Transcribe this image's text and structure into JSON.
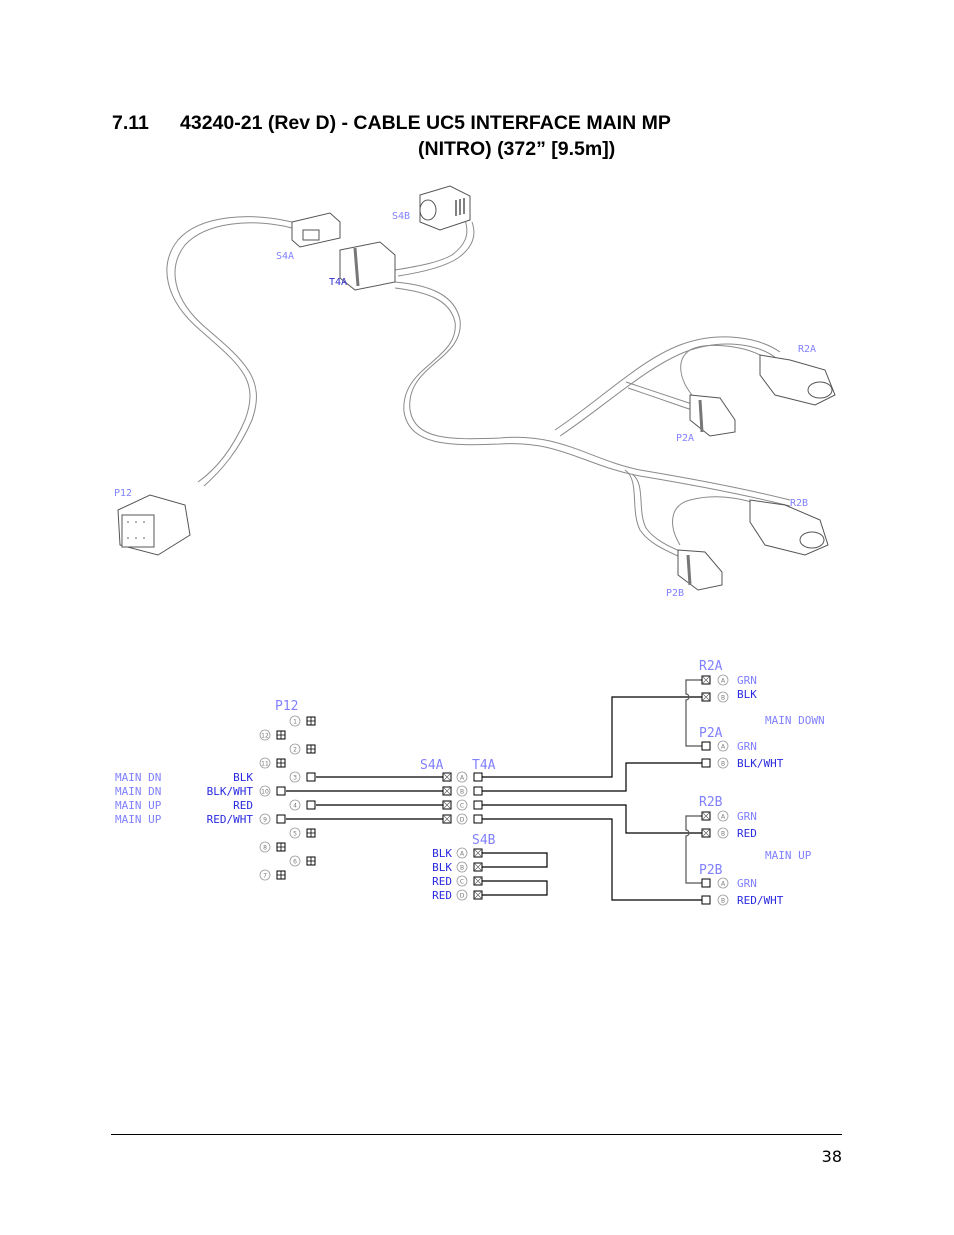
{
  "page": {
    "section_number": "7.11",
    "title_line1": "43240-21 (Rev D) - CABLE UC5 INTERFACE MAIN MP",
    "title_line2": "(NITRO) (372” [9.5m])",
    "page_number": "38"
  },
  "drawing_labels": {
    "s4b": "S4B",
    "s4a": "S4A",
    "t4a": "T4A",
    "p12": "P12",
    "r2a": "R2A",
    "p2a": "P2A",
    "r2b": "R2B",
    "p2b": "P2B"
  },
  "schematic": {
    "p12": {
      "label": "P12",
      "pins": [
        "1",
        "12",
        "2",
        "11",
        "3",
        "10",
        "4",
        "9",
        "5",
        "8",
        "6",
        "7"
      ],
      "wired_pins": [
        {
          "pin": "3",
          "function": "MAIN DN",
          "color": "BLK"
        },
        {
          "pin": "10",
          "function": "MAIN DN",
          "color": "BLK/WHT"
        },
        {
          "pin": "4",
          "function": "MAIN UP",
          "color": "RED"
        },
        {
          "pin": "9",
          "function": "MAIN UP",
          "color": "RED/WHT"
        }
      ]
    },
    "s4a": {
      "label": "S4A",
      "pins": [
        "A",
        "B",
        "C",
        "D"
      ]
    },
    "t4a": {
      "label": "T4A"
    },
    "s4b": {
      "label": "S4B",
      "pins": [
        {
          "pin": "A",
          "color": "BLK"
        },
        {
          "pin": "B",
          "color": "BLK"
        },
        {
          "pin": "C",
          "color": "RED"
        },
        {
          "pin": "D",
          "color": "RED"
        }
      ]
    },
    "r2a": {
      "label": "R2A",
      "pins": [
        {
          "pin": "A",
          "color": "GRN"
        },
        {
          "pin": "B",
          "color": "BLK"
        }
      ]
    },
    "main_down": "MAIN DOWN",
    "p2a": {
      "label": "P2A",
      "pins": [
        {
          "pin": "A",
          "color": "GRN"
        },
        {
          "pin": "B",
          "color": "BLK/WHT"
        }
      ]
    },
    "r2b": {
      "label": "R2B",
      "pins": [
        {
          "pin": "A",
          "color": "GRN"
        },
        {
          "pin": "B",
          "color": "RED"
        }
      ]
    },
    "main_up": "MAIN UP",
    "p2b": {
      "label": "P2B",
      "pins": [
        {
          "pin": "A",
          "color": "GRN"
        },
        {
          "pin": "B",
          "color": "RED/WHT"
        }
      ]
    }
  },
  "colors": {
    "label_light": "#8080ff",
    "label_dark": "#0000cc",
    "line": "#000000",
    "drawing": "#888888"
  }
}
